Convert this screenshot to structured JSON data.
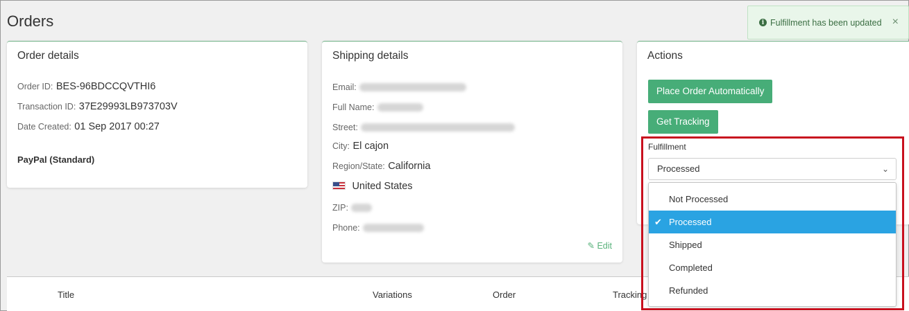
{
  "page": {
    "title": "Orders"
  },
  "toast": {
    "message": "Fulfillment has been updated",
    "close": "×",
    "icon": "info-icon"
  },
  "order_details": {
    "title": "Order details",
    "order_id_label": "Order ID:",
    "order_id": "BES-96BDCCQVTHI6",
    "transaction_id_label": "Transaction ID:",
    "transaction_id": "37E29993LB973703V",
    "date_created_label": "Date Created:",
    "date_created": "01 Sep 2017 00:27",
    "payment_method": "PayPal (Standard)"
  },
  "shipping_details": {
    "title": "Shipping details",
    "email_label": "Email:",
    "full_name_label": "Full Name:",
    "street_label": "Street:",
    "city_label": "City:",
    "city": "El cajon",
    "region_label": "Region/State:",
    "region": "California",
    "country": "United States",
    "zip_label": "ZIP:",
    "phone_label": "Phone:",
    "edit_label": "Edit"
  },
  "actions": {
    "title": "Actions",
    "place_order_label": "Place Order Automatically",
    "get_tracking_label": "Get Tracking",
    "fulfillment_label": "Fulfillment",
    "fulfillment_selected": "Processed",
    "fulfillment_options": [
      "Not Processed",
      "Processed",
      "Shipped",
      "Completed",
      "Refunded"
    ]
  },
  "table": {
    "headers": [
      "Title",
      "Variations",
      "Order",
      "Tracking"
    ]
  },
  "colors": {
    "accent_green": "#47ad78",
    "selected_blue": "#2aa3e2",
    "highlight_red": "#c8101e"
  }
}
